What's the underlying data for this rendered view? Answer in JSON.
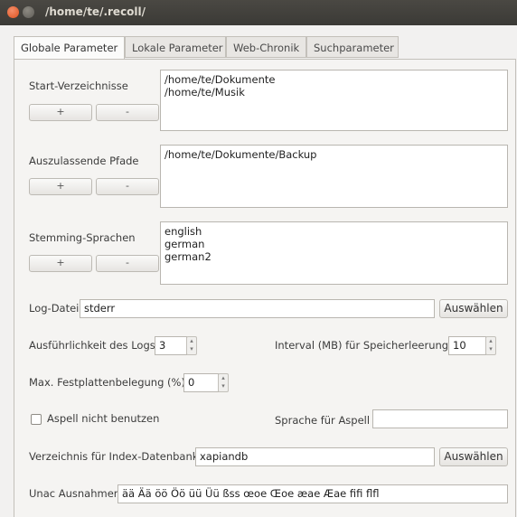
{
  "window": {
    "title": "/home/te/.recoll/"
  },
  "tabs": [
    {
      "label": "Globale Parameter"
    },
    {
      "label": "Lokale Parameter"
    },
    {
      "label": "Web-Chronik"
    },
    {
      "label": "Suchparameter"
    }
  ],
  "start_dirs": {
    "label": "Start-Verzeichnisse",
    "items": [
      "/home/te/Dokumente",
      "/home/te/Musik"
    ],
    "add_label": "+",
    "remove_label": "-"
  },
  "skipped_paths": {
    "label": "Auszulassende Pfade",
    "items": [
      "/home/te/Dokumente/Backup"
    ],
    "add_label": "+",
    "remove_label": "-"
  },
  "stemming": {
    "label": "Stemming-Sprachen",
    "items": [
      "english",
      "german",
      "german2"
    ],
    "add_label": "+",
    "remove_label": "-"
  },
  "log_file": {
    "label": "Log-Datei",
    "value": "stderr",
    "choose_label": "Auswählen"
  },
  "log_verbosity": {
    "label": "Ausführlichkeit des Logs",
    "value": "3"
  },
  "flush_interval": {
    "label": "Interval (MB) für Speicherleerung",
    "value": "10"
  },
  "max_disk": {
    "label": "Max. Festplattenbelegung (%)",
    "value": "0"
  },
  "no_aspell": {
    "label": "Aspell nicht benutzen",
    "checked": false
  },
  "aspell_language": {
    "label": "Sprache für Aspell",
    "value": ""
  },
  "index_db": {
    "label": "Verzeichnis für Index-Datenbank",
    "value": "xapiandb",
    "choose_label": "Auswählen"
  },
  "unac": {
    "label": "Unac Ausnahmen",
    "value": "ää Ää öö Öö üü Üü ßss œoe Œoe æae Æae ﬁfi ﬂfl"
  }
}
